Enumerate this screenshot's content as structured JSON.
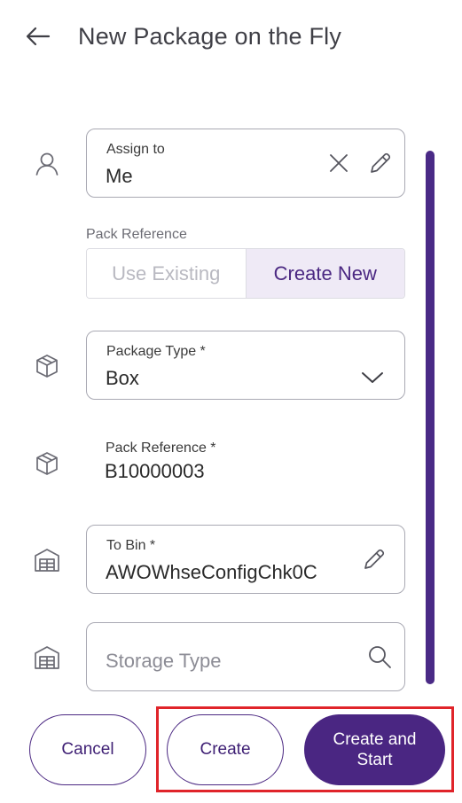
{
  "header": {
    "title": "New Package on the Fly",
    "back_icon": "arrow-left-icon"
  },
  "assign_to": {
    "label": "Assign to",
    "value": "Me",
    "clear_icon": "close-icon",
    "edit_icon": "pencil-icon",
    "row_icon": "user-icon"
  },
  "pack_reference_mode": {
    "label": "Pack Reference",
    "options": [
      "Use Existing",
      "Create New"
    ],
    "selected": "Create New"
  },
  "package_type": {
    "label": "Package Type *",
    "value": "Box",
    "dropdown_icon": "chevron-down-icon",
    "row_icon": "package-icon"
  },
  "pack_reference": {
    "label": "Pack Reference *",
    "value": "B10000003",
    "row_icon": "package-icon"
  },
  "to_bin": {
    "label": "To Bin *",
    "value": "AWOWhseConfigChk0C",
    "edit_icon": "pencil-icon",
    "row_icon": "warehouse-icon"
  },
  "storage_type": {
    "placeholder": "Storage Type",
    "search_icon": "search-icon",
    "row_icon": "warehouse-icon"
  },
  "actions": {
    "cancel": "Cancel",
    "create": "Create",
    "create_and_start": "Create and Start"
  },
  "colors": {
    "accent": "#4a2682",
    "selected_segment_bg": "#efeaf6",
    "highlight": "#e0242a"
  }
}
